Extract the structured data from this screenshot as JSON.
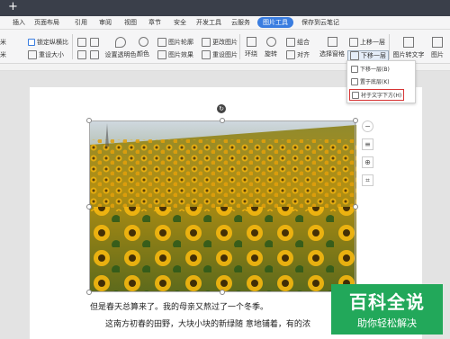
{
  "titlebar": {
    "new_tab": "+"
  },
  "tabs": [
    "插入",
    "页面布局",
    "引用",
    "审阅",
    "视图",
    "章节",
    "安全",
    "开发工具",
    "云服务",
    "图片工具",
    "保存到云笔记"
  ],
  "active_tab": "图片工具",
  "toolbar": {
    "width_value": "米",
    "height_value": "米",
    "lock_ratio": "锁定纵横比",
    "reset_size": "重设大小",
    "set_transparent": "设置透明色",
    "color": "颜色",
    "image_outline": "图片轮廓",
    "image_effect": "图片效果",
    "change_image": "更改图片",
    "reset_image": "重设图片",
    "wrap": "环绕",
    "rotate": "旋转",
    "combine": "组合",
    "align": "对齐",
    "selection_pane": "选择窗格",
    "bring_forward": "上移一层",
    "send_backward": "下移一层",
    "image_to_text": "图片转文字",
    "image_translate": "图片"
  },
  "dropdown": {
    "items": [
      "下移一层(B)",
      "置于底层(K)",
      "衬于文字下方(H)"
    ]
  },
  "image_tools": {
    "rotate_icon": "rotate-icon",
    "side": [
      "layout-options-icon",
      "zoom-icon",
      "crop-icon"
    ]
  },
  "body": {
    "line1": "但是春天总算来了。我的母亲又熬过了一个冬季。",
    "line2": "这南方初春的田野，大块小块的新绿随 意地铺着，有的浓"
  },
  "watermark": {
    "line1": "百科全说",
    "line2": "助你轻松解决"
  },
  "colors": {
    "accent": "#3a7de0",
    "highlight": "#d63434",
    "watermark": "#22a85a"
  }
}
